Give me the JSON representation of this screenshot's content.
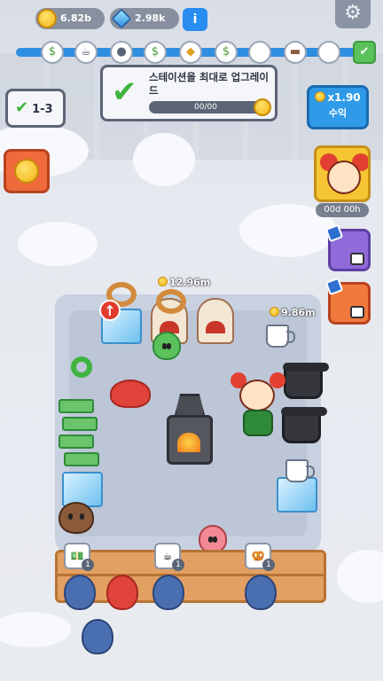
{
  "hud": {
    "coins": "6.82b",
    "gems": "2.98k",
    "info_label": "i",
    "settings_icon": "gear-icon"
  },
  "progress_nodes": [
    {
      "icon": "cash-icon",
      "state": "done"
    },
    {
      "icon": "mug-icon",
      "state": "done"
    },
    {
      "icon": "pot-icon",
      "state": "done"
    },
    {
      "icon": "cash-icon",
      "state": "done"
    },
    {
      "icon": "bulb-icon",
      "state": "done"
    },
    {
      "icon": "cash-icon",
      "state": "done"
    },
    {
      "icon": "empty",
      "state": "pending"
    },
    {
      "icon": "bread-icon",
      "state": "pending"
    },
    {
      "icon": "empty",
      "state": "pending"
    },
    {
      "icon": "check-icon",
      "state": "goal"
    }
  ],
  "quest": {
    "text": "스테이션을 최대로 업그레이드",
    "progress_text": "00/00"
  },
  "level": {
    "label": "1-3"
  },
  "income": {
    "multiplier": "x1.90",
    "label": "수익"
  },
  "timer": "00d 00h",
  "prices": {
    "pretzel_station": "12.96m",
    "mug_station": "9.86m"
  },
  "orders": [
    {
      "icon": "cash-icon",
      "count": "1"
    },
    {
      "icon": "mug-icon",
      "count": "1"
    },
    {
      "icon": "bread-icon",
      "count": "1"
    }
  ],
  "colors": {
    "accent_blue": "#2f8ee0",
    "success_green": "#3fb43f",
    "side_button_orange": "#ef6a3c",
    "char_button_yellow": "#f5c533"
  }
}
